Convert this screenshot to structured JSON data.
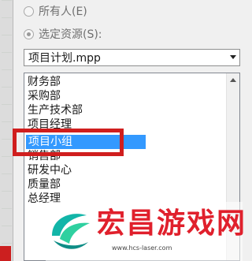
{
  "sharing": {
    "radio_everyone_label": "所有人(E)",
    "radio_selected_label": "选定资源(S):"
  },
  "project_combo": {
    "value": "项目计划.mpp"
  },
  "resources_list": {
    "items": [
      "财务部",
      "采购部",
      "生产技术部",
      "项目经理",
      "项目小组",
      "销售部",
      "研发中心",
      "质量部",
      "总经理"
    ],
    "selected": "项目小组"
  },
  "watermark": {
    "title": "宏昌游戏网",
    "url": "www.hcs-laser.com"
  },
  "colors": {
    "selection": "#3399ff",
    "highlight_box": "#d01e1e",
    "watermark_red": "#e0202c"
  }
}
